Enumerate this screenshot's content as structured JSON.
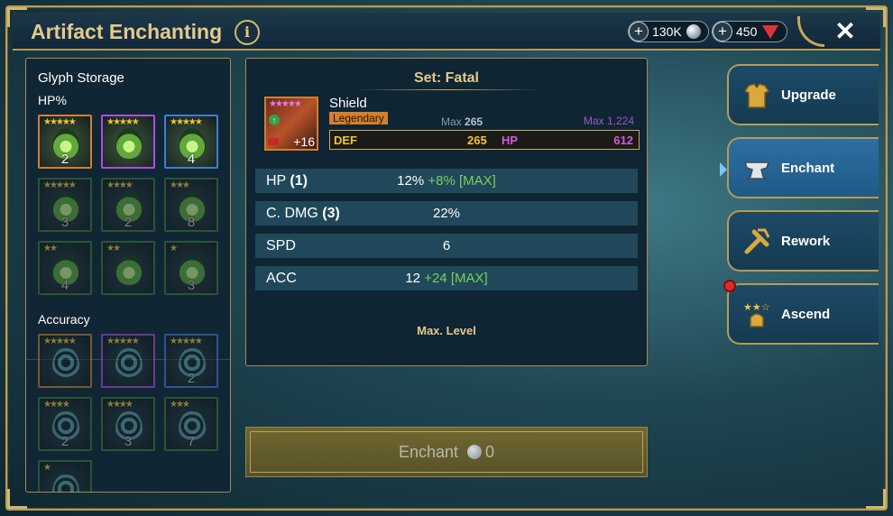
{
  "header": {
    "title": "Artifact Enchanting",
    "info_icon": "i",
    "silver": "130K",
    "gems": "450",
    "close": "✕",
    "plus": "+"
  },
  "storage": {
    "title": "Glyph Storage",
    "sections": [
      {
        "label": "HP%",
        "glyphs": [
          {
            "stars": "★★★★★",
            "count": "2",
            "rarity": "orange",
            "active": true
          },
          {
            "stars": "★★★★★",
            "count": "",
            "rarity": "purple",
            "active": true
          },
          {
            "stars": "★★★★★",
            "count": "4",
            "rarity": "blue",
            "active": true
          },
          {
            "stars": "★★★★★",
            "count": "3",
            "rarity": "green",
            "active": false
          },
          {
            "stars": "★★★★",
            "count": "2",
            "rarity": "green",
            "active": false
          },
          {
            "stars": "★★★",
            "count": "8",
            "rarity": "green",
            "active": false
          },
          {
            "stars": "★★",
            "count": "4",
            "rarity": "green",
            "active": false
          },
          {
            "stars": "★★",
            "count": "",
            "rarity": "green",
            "active": false
          },
          {
            "stars": "★",
            "count": "3",
            "rarity": "green",
            "active": false
          }
        ]
      },
      {
        "label": "Accuracy",
        "glyphs": [
          {
            "stars": "★★★★★",
            "count": "",
            "rarity": "orange",
            "active": false
          },
          {
            "stars": "★★★★★",
            "count": "",
            "rarity": "purple",
            "active": false
          },
          {
            "stars": "★★★★★",
            "count": "2",
            "rarity": "blue",
            "active": false
          },
          {
            "stars": "★★★★",
            "count": "2",
            "rarity": "green",
            "active": false
          },
          {
            "stars": "★★★★",
            "count": "3",
            "rarity": "green",
            "active": false
          },
          {
            "stars": "★★★",
            "count": "7",
            "rarity": "green",
            "active": false
          },
          {
            "stars": "★",
            "count": "",
            "rarity": "green",
            "active": false
          }
        ]
      }
    ]
  },
  "artifact": {
    "set": "Set: Fatal",
    "name": "Shield",
    "rarity": "Legendary",
    "stars": "★★★★★",
    "level": "+16",
    "max_main_label": "Max",
    "max_main_value": "265",
    "max_sub": "Max 1,224",
    "main_stat": {
      "name": "DEF",
      "value": "265"
    },
    "sub_stat_top": {
      "name": "HP",
      "value": "612"
    },
    "substats": [
      {
        "name": "HP",
        "rolls": "(1)",
        "value": "12%",
        "bonus": "+8% [MAX]"
      },
      {
        "name": "C. DMG",
        "rolls": "(3)",
        "value": "22%",
        "bonus": ""
      },
      {
        "name": "SPD",
        "rolls": "",
        "value": "6",
        "bonus": ""
      },
      {
        "name": "ACC",
        "rolls": "",
        "value": "12",
        "bonus": "+24 [MAX]"
      }
    ],
    "status": "Max. Level"
  },
  "enchant_button": {
    "label": "Enchant",
    "cost": "0"
  },
  "tabs": [
    {
      "label": "Upgrade",
      "icon": "armor-icon",
      "active": false,
      "notify": false
    },
    {
      "label": "Enchant",
      "icon": "anvil-icon",
      "active": true,
      "notify": false
    },
    {
      "label": "Rework",
      "icon": "tools-icon",
      "active": false,
      "notify": false
    },
    {
      "label": "Ascend",
      "icon": "ascend-helmet-icon",
      "active": false,
      "notify": true
    }
  ],
  "colors": {
    "gold": "#e4c98c",
    "legendary": "#d37f2d",
    "epic": "#b14ce0",
    "rare": "#3c7ed8",
    "uncommon": "#3f7a34",
    "bonus": "#7ad05a",
    "hp_stat": "#d05bd6"
  }
}
